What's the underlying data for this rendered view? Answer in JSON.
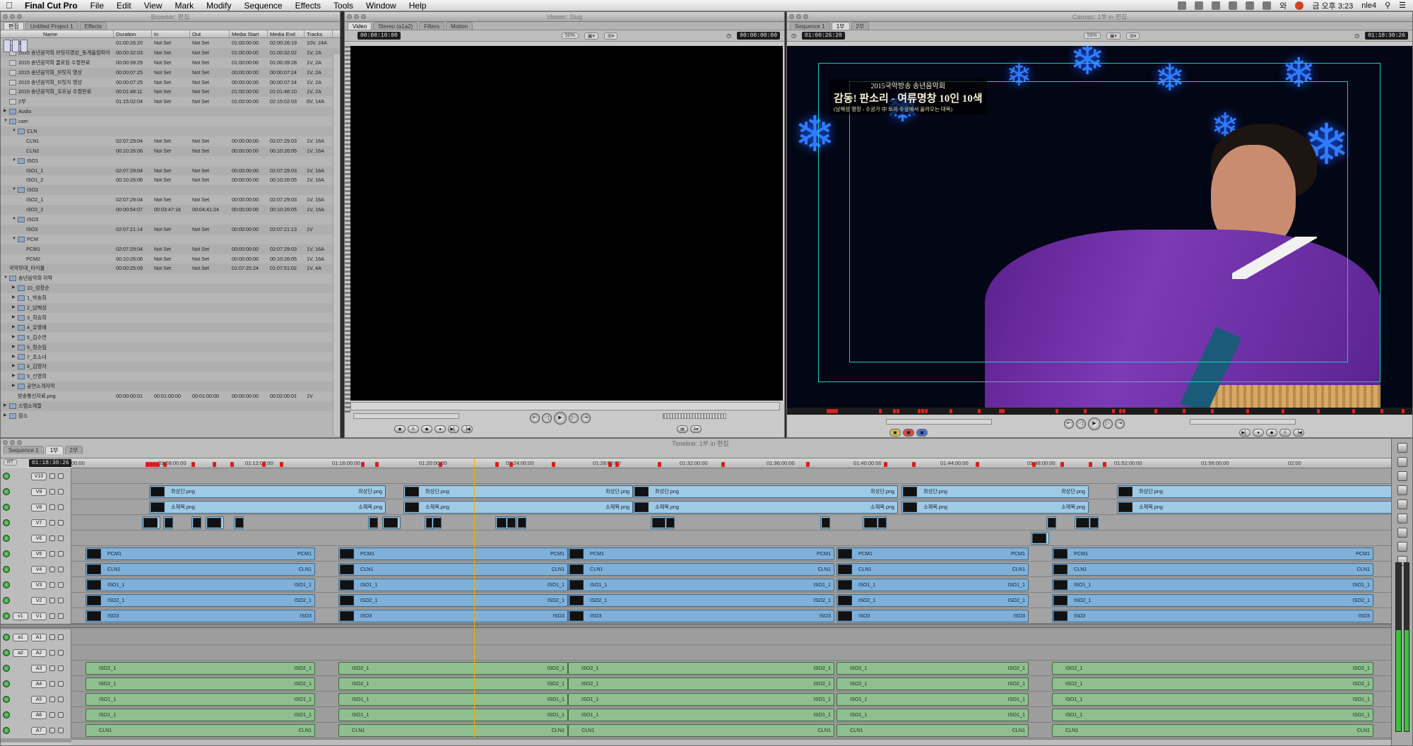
{
  "menubar": {
    "apple": "",
    "app": "Final Cut Pro",
    "items": [
      "File",
      "Edit",
      "View",
      "Mark",
      "Modify",
      "Sequence",
      "Effects",
      "Tools",
      "Window",
      "Help"
    ],
    "clock": "금 오후 3:23",
    "user": "nle4",
    "battery": "와"
  },
  "browser": {
    "title": "Browser: 편집",
    "tabs": [
      "편집",
      "Untitled Project 1",
      "Effects"
    ],
    "columns": [
      "Name",
      "Duration",
      "In",
      "Out",
      "Media Start",
      "Media End",
      "Tracks"
    ],
    "rows": [
      {
        "indent": 0,
        "tri": "",
        "icon": "seq",
        "name": "1부",
        "dur": "01:00:26:20",
        "in": "Not Set",
        "out": "Not Set",
        "ms": "01:00:00:00",
        "me": "02:00:26:19",
        "tr": "10V, 24A"
      },
      {
        "indent": 0,
        "tri": "",
        "icon": "seq",
        "name": "2015 송년음악회 브릿지영상_동계올림피아",
        "dur": "00:00:32:03",
        "in": "Not Set",
        "out": "Not Set",
        "ms": "01:00:00:00",
        "me": "01:00:32:02",
        "tr": "1V, 2A"
      },
      {
        "indent": 0,
        "tri": "",
        "icon": "seq",
        "name": "2015 송년음악회 클로징 수정완료",
        "dur": "00:00:39:29",
        "in": "Not Set",
        "out": "Not Set",
        "ms": "01:00:00:00",
        "me": "01:00:39:28",
        "tr": "1V, 2A"
      },
      {
        "indent": 0,
        "tri": "",
        "icon": "seq",
        "name": "2015 송년음악회_브릿지 영상",
        "dur": "00:00:07:25",
        "in": "Not Set",
        "out": "Not Set",
        "ms": "00:00:00:00",
        "me": "00:00:07:24",
        "tr": "1V, 2A"
      },
      {
        "indent": 0,
        "tri": "",
        "icon": "seq",
        "name": "2015 송년음악회_브릿지 영상",
        "dur": "00:00:07:25",
        "in": "Not Set",
        "out": "Not Set",
        "ms": "00:00:00:00",
        "me": "00:00:07:24",
        "tr": "1V, 2A"
      },
      {
        "indent": 0,
        "tri": "",
        "icon": "seq",
        "name": "2015 송년음악회_오프닝 수정완료",
        "dur": "00:01:48:11",
        "in": "Not Set",
        "out": "Not Set",
        "ms": "01:00:00:00",
        "me": "01:01:48:10",
        "tr": "1V, 2A"
      },
      {
        "indent": 0,
        "tri": "",
        "icon": "seq",
        "name": "2부",
        "dur": "01:15:02:04",
        "in": "Not Set",
        "out": "Not Set",
        "ms": "01:00:00:00",
        "me": "02:15:02:03",
        "tr": "6V, 14A"
      },
      {
        "indent": 0,
        "tri": "▶",
        "icon": "bin",
        "name": "Audio",
        "dur": "",
        "in": "",
        "out": "",
        "ms": "",
        "me": "",
        "tr": ""
      },
      {
        "indent": 0,
        "tri": "▼",
        "icon": "bin",
        "name": "cam",
        "dur": "",
        "in": "",
        "out": "",
        "ms": "",
        "me": "",
        "tr": ""
      },
      {
        "indent": 1,
        "tri": "▼",
        "icon": "bin",
        "name": "CLN",
        "dur": "",
        "in": "",
        "out": "",
        "ms": "",
        "me": "",
        "tr": ""
      },
      {
        "indent": 2,
        "tri": "",
        "icon": "clip",
        "name": "CLN1",
        "dur": "02:07:29:04",
        "in": "Not Set",
        "out": "Not Set",
        "ms": "00:00:00:00",
        "me": "02:07:29:03",
        "tr": "1V, 16A"
      },
      {
        "indent": 2,
        "tri": "",
        "icon": "clip",
        "name": "CLN2",
        "dur": "00:10:26:06",
        "in": "Not Set",
        "out": "Not Set",
        "ms": "00:00:00:00",
        "me": "00:10:26:05",
        "tr": "1V, 16A"
      },
      {
        "indent": 1,
        "tri": "▼",
        "icon": "bin",
        "name": "ISO1",
        "dur": "",
        "in": "",
        "out": "",
        "ms": "",
        "me": "",
        "tr": ""
      },
      {
        "indent": 2,
        "tri": "",
        "icon": "clip",
        "name": "ISO1_1",
        "dur": "02:07:29:04",
        "in": "Not Set",
        "out": "Not Set",
        "ms": "00:00:00:00",
        "me": "02:07:29:03",
        "tr": "1V, 16A"
      },
      {
        "indent": 2,
        "tri": "",
        "icon": "clip",
        "name": "ISO1_2",
        "dur": "00:10:26:06",
        "in": "Not Set",
        "out": "Not Set",
        "ms": "00:00:00:00",
        "me": "00:10:26:05",
        "tr": "1V, 16A"
      },
      {
        "indent": 1,
        "tri": "▼",
        "icon": "bin",
        "name": "ISO2",
        "dur": "",
        "in": "",
        "out": "",
        "ms": "",
        "me": "",
        "tr": ""
      },
      {
        "indent": 2,
        "tri": "",
        "icon": "clip",
        "name": "ISO2_1",
        "dur": "02:07:29:04",
        "in": "Not Set",
        "out": "Not Set",
        "ms": "00:00:00:00",
        "me": "02:07:29:03",
        "tr": "1V, 16A"
      },
      {
        "indent": 2,
        "tri": "",
        "icon": "clip",
        "name": "ISO2_2",
        "dur": "00:00:54:07",
        "in": "00:03:47:16",
        "out": "00:04:41:24",
        "ms": "00:00:00:00",
        "me": "00:10:26:05",
        "tr": "1V, 16A"
      },
      {
        "indent": 1,
        "tri": "▼",
        "icon": "bin",
        "name": "ISO3",
        "dur": "",
        "in": "",
        "out": "",
        "ms": "",
        "me": "",
        "tr": ""
      },
      {
        "indent": 2,
        "tri": "",
        "icon": "clip",
        "name": "ISO3",
        "dur": "02:07:21:14",
        "in": "Not Set",
        "out": "Not Set",
        "ms": "00:00:00:00",
        "me": "02:07:21:13",
        "tr": "1V"
      },
      {
        "indent": 1,
        "tri": "▼",
        "icon": "bin",
        "name": "PCM",
        "dur": "",
        "in": "",
        "out": "",
        "ms": "",
        "me": "",
        "tr": ""
      },
      {
        "indent": 2,
        "tri": "",
        "icon": "clip",
        "name": "PCM1",
        "dur": "02:07:29:04",
        "in": "Not Set",
        "out": "Not Set",
        "ms": "00:00:00:00",
        "me": "02:07:29:03",
        "tr": "1V, 16A"
      },
      {
        "indent": 2,
        "tri": "",
        "icon": "clip",
        "name": "PCM2",
        "dur": "00:10:26:06",
        "in": "Not Set",
        "out": "Not Set",
        "ms": "00:00:00:00",
        "me": "00:10:26:05",
        "tr": "1V, 16A"
      },
      {
        "indent": 0,
        "tri": "",
        "icon": "clip",
        "name": "국악무대_타이틀",
        "dur": "00:00:25:09",
        "in": "Not Set",
        "out": "Not Set",
        "ms": "01:07:25:24",
        "me": "01:07:51:02",
        "tr": "1V, 4A"
      },
      {
        "indent": 0,
        "tri": "▼",
        "icon": "bin",
        "name": "송년음악회 자막",
        "dur": "",
        "in": "",
        "out": "",
        "ms": "",
        "me": "",
        "tr": ""
      },
      {
        "indent": 1,
        "tri": "▶",
        "icon": "bin",
        "name": "10_성창순",
        "dur": "",
        "in": "",
        "out": "",
        "ms": "",
        "me": "",
        "tr": ""
      },
      {
        "indent": 1,
        "tri": "▶",
        "icon": "bin",
        "name": "1_박송희",
        "dur": "",
        "in": "",
        "out": "",
        "ms": "",
        "me": "",
        "tr": ""
      },
      {
        "indent": 1,
        "tri": "▶",
        "icon": "bin",
        "name": "2_남해성",
        "dur": "",
        "in": "",
        "out": "",
        "ms": "",
        "me": "",
        "tr": ""
      },
      {
        "indent": 1,
        "tri": "▶",
        "icon": "bin",
        "name": "3_최승희",
        "dur": "",
        "in": "",
        "out": "",
        "ms": "",
        "me": "",
        "tr": ""
      },
      {
        "indent": 1,
        "tri": "▶",
        "icon": "bin",
        "name": "4_유영애",
        "dur": "",
        "in": "",
        "out": "",
        "ms": "",
        "me": "",
        "tr": ""
      },
      {
        "indent": 1,
        "tri": "▶",
        "icon": "bin",
        "name": "5_김수연",
        "dur": "",
        "in": "",
        "out": "",
        "ms": "",
        "me": "",
        "tr": ""
      },
      {
        "indent": 1,
        "tri": "▶",
        "icon": "bin",
        "name": "6_정순임",
        "dur": "",
        "in": "",
        "out": "",
        "ms": "",
        "me": "",
        "tr": ""
      },
      {
        "indent": 1,
        "tri": "▶",
        "icon": "bin",
        "name": "7_조소녀",
        "dur": "",
        "in": "",
        "out": "",
        "ms": "",
        "me": "",
        "tr": ""
      },
      {
        "indent": 1,
        "tri": "▶",
        "icon": "bin",
        "name": "8_김영자",
        "dur": "",
        "in": "",
        "out": "",
        "ms": "",
        "me": "",
        "tr": ""
      },
      {
        "indent": 1,
        "tri": "▶",
        "icon": "bin",
        "name": "9_신영희",
        "dur": "",
        "in": "",
        "out": "",
        "ms": "",
        "me": "",
        "tr": ""
      },
      {
        "indent": 1,
        "tri": "▶",
        "icon": "bin",
        "name": "공연소개자막",
        "dur": "",
        "in": "",
        "out": "",
        "ms": "",
        "me": "",
        "tr": ""
      },
      {
        "indent": 1,
        "tri": "",
        "icon": "clip",
        "name": "방송통신자료.png",
        "dur": "00:00:00:01",
        "in": "00:01:00:00",
        "out": "00:01:00:00",
        "ms": "00:00:00:00",
        "me": "00:02:00:01",
        "tr": "1V"
      },
      {
        "indent": 0,
        "tri": "▶",
        "icon": "bin",
        "name": "스템소재들",
        "dur": "",
        "in": "",
        "out": "",
        "ms": "",
        "me": "",
        "tr": ""
      },
      {
        "indent": 0,
        "tri": "▶",
        "icon": "bin",
        "name": "참소",
        "dur": "",
        "in": "",
        "out": "",
        "ms": "",
        "me": "",
        "tr": ""
      }
    ]
  },
  "viewer": {
    "title": "Viewer: Slug",
    "tabs": [
      "Video",
      "Stereo (a1a2)",
      "Filters",
      "Motion"
    ],
    "timecode_dur": "00:00:10:00",
    "zoom": "50%",
    "timecode_cur": "00:00:00:00"
  },
  "canvas": {
    "title": "Canvas: 1부 in 편집",
    "tabs": [
      "Sequence 1",
      "1부",
      "2부"
    ],
    "timecode_dur": "01:00:26:20",
    "zoom": "59%",
    "timecode_cur": "01:18:30:26",
    "lower_third": {
      "line1": "2015국악방송 송년음악회",
      "line2": "감동! 판소리 - 여류명창 10인 10색",
      "line3": "(남해성 명창 - 수궁가 中 토끼 수궁에서 올라오는 대목)"
    }
  },
  "timeline": {
    "title": "Timeline: 1부 in 편집",
    "tabs": [
      "Sequence 1",
      "1부",
      "2부"
    ],
    "rt": "RT",
    "timecode": "01:18:30:26",
    "ruler": [
      "00:00",
      "01:08:00:00",
      "01:12:00:00",
      "01:16:00:00",
      "01:20:00:00",
      "01:24:00:00",
      "01:28:00:00",
      "01:32:00:00",
      "01:36:00:00",
      "01:40:00:00",
      "01:44:00:00",
      "01:48:00:00",
      "01:52:00:00",
      "01:56:00:00",
      "02:00"
    ],
    "video_tracks": [
      "V10",
      "V9",
      "V8",
      "V7",
      "V6",
      "V5",
      "V4",
      "V3",
      "V2",
      "V1"
    ],
    "audio_tracks": [
      "A1",
      "A2",
      "A3",
      "A4",
      "A5",
      "A6",
      "A7"
    ],
    "dest_video": "v1",
    "dest_audio": [
      "a1",
      "a2"
    ],
    "clip_names": {
      "v9": "좌상단.png",
      "v8": "소제목.png",
      "v5": "PCM1",
      "v4": "CLN1",
      "v3": "ISO1_1",
      "v2": "ISO2_1",
      "v1": "ISO3",
      "a3": "ISO2_1",
      "a4": "ISO2_1",
      "a5": "ISO1_1",
      "a6": "ISO1_1",
      "a7": "CLN1"
    }
  }
}
